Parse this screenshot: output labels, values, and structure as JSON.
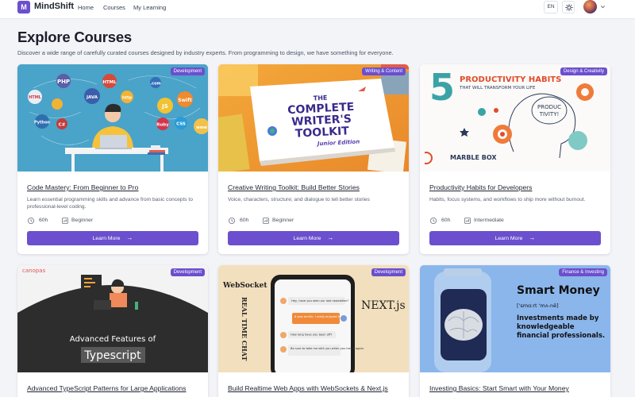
{
  "header": {
    "logo_letter": "M",
    "brand": "MindShift",
    "nav": [
      "Home",
      "Courses",
      "My Learning"
    ],
    "lang": "EN"
  },
  "page": {
    "title": "Explore Courses",
    "subtitle": "Discover a wide range of carefully curated courses designed by industry experts. From programming to design, we have something for everyone."
  },
  "courses": [
    {
      "badge": "Development",
      "title": "Code Mastery: From Beginner to Pro",
      "description": "Learn essential programming skills and advance from basic concepts to professional-level coding.",
      "duration": "60h",
      "level": "Beginner",
      "button": "Learn More",
      "image_text": [
        "PHP",
        "HTML",
        "JAVA",
        "http",
        ".com",
        "Swift",
        "JS",
        "Python",
        "C#",
        "Ruby",
        "CSS",
        "www"
      ]
    },
    {
      "badge": "Writing & Content",
      "title": "Creative Writing Toolkit: Build Better Stories",
      "description": "Voice, characters, structure; and dialogue to tell better stories",
      "duration": "60h",
      "level": "Beginner",
      "button": "Learn More",
      "image_text": [
        "THE",
        "COMPLETE",
        "WRITER'S",
        "TOOLKIT",
        "Junior Edition"
      ]
    },
    {
      "badge": "Design & Creativity",
      "title": "Productivity Habits for Developers",
      "description": "Habits, focus systems, and workflows to ship more without burnout.",
      "duration": "60h",
      "level": "Intermediate",
      "button": "Learn More",
      "image_text": [
        "5",
        "PRODUCTIVITY HABITS",
        "THAT WILL TRANSFORM YOUR LIFE",
        "PRODUC TIVITY!",
        "MARBLE BOX"
      ]
    },
    {
      "badge": "Development",
      "title": "Advanced TypeScript Patterns for Large Applications",
      "image_text": [
        "canopas",
        "Advanced Features of",
        "Typescript"
      ]
    },
    {
      "badge": "Development",
      "title": "Build Realtime Web Apps with WebSockets & Next.js",
      "image_text": [
        "WebSocket",
        "REAL TIME CHAT",
        "NEXT.js",
        "Hey, have you seen our last newsletter?",
        "It was terrific. I really enjoyed it.",
        "How long have you been off?",
        "Be sure to take me with you when you travel again."
      ]
    },
    {
      "badge": "Finance & Investing",
      "title": "Investing Basics: Start Smart with Your Money",
      "image_text": [
        "Smart Money",
        "['smɑːrt 'mʌ-nē]",
        "Investments made by knowledgeable financial professionals."
      ]
    }
  ],
  "colors": {
    "accent": "#6b4fce",
    "background": "#f3f4f8"
  }
}
